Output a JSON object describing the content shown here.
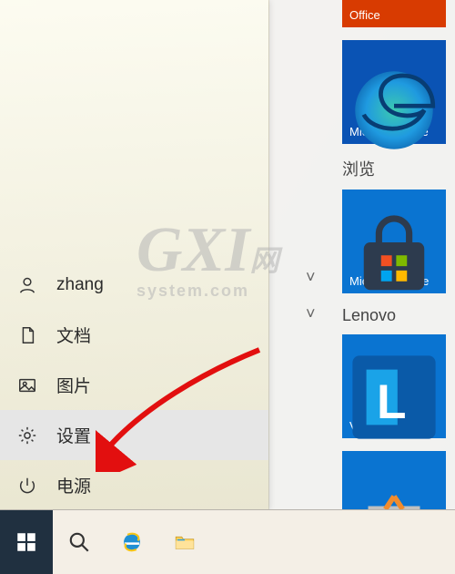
{
  "rail": {
    "user": {
      "label": "zhang"
    },
    "documents": {
      "label": "文档"
    },
    "pictures": {
      "label": "图片"
    },
    "settings": {
      "label": "设置"
    },
    "power": {
      "label": "电源"
    }
  },
  "apps": {
    "top_partial_label": "Office",
    "edge_label": "Microsoft Edge",
    "group_browse": "浏览",
    "store_label": "Microsoft Store",
    "group_lenovo": "Lenovo",
    "vantage_label": "Vantage"
  },
  "watermark": {
    "big": "GXI",
    "sub": "system.com",
    "net": "网"
  }
}
